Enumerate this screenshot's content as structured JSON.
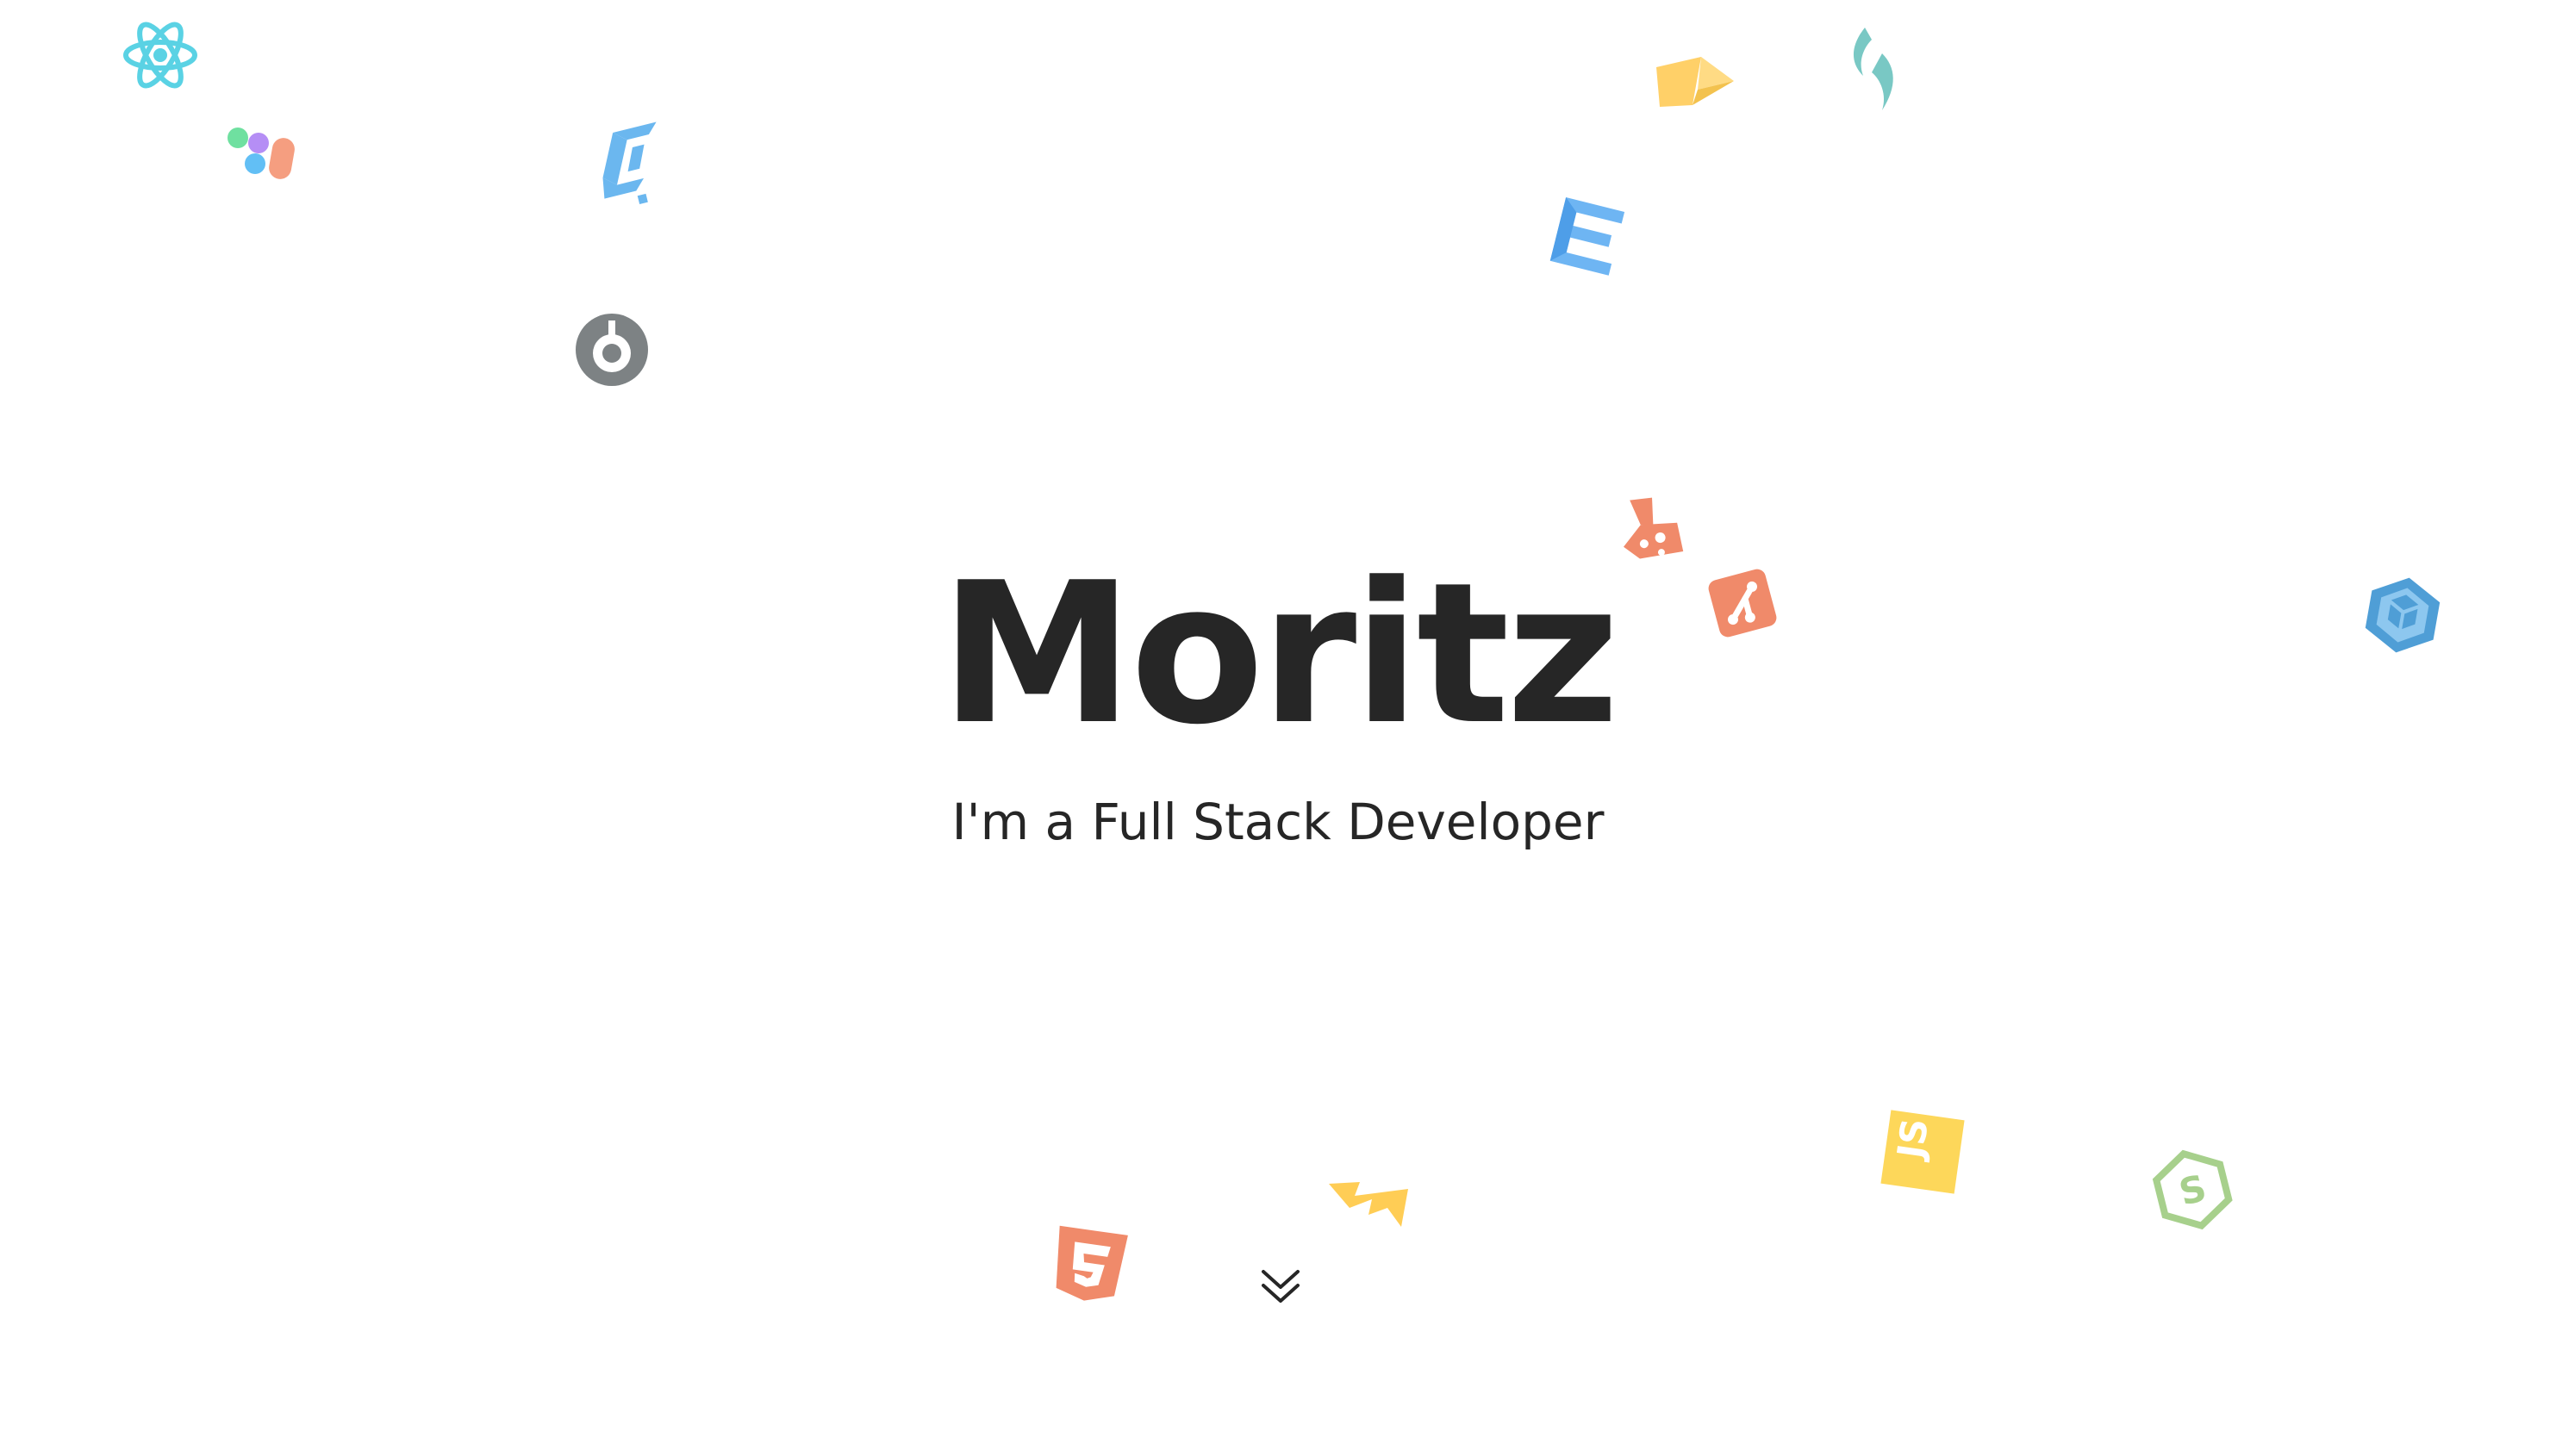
{
  "hero": {
    "name": "Moritz",
    "tagline": "I'm a Full Stack Developer"
  },
  "scroll_hint": {
    "icon": "double-chevron-down-icon"
  },
  "floating_icons": [
    {
      "name": "react-icon",
      "color": "#5ad2e4"
    },
    {
      "name": "figma-icon",
      "color": "#f59e80"
    },
    {
      "name": "webpack-icon",
      "color": "#6bb7ef"
    },
    {
      "name": "circleci-icon",
      "color": "#7d8284"
    },
    {
      "name": "prisma-icon",
      "color": "#ffd068"
    },
    {
      "name": "tailwind-icon",
      "color": "#79c8c4"
    },
    {
      "name": "css3-icon",
      "color": "#6eb5f3"
    },
    {
      "name": "gatling-icon",
      "color": "#f08a6a"
    },
    {
      "name": "git-icon",
      "color": "#f08a6a"
    },
    {
      "name": "kubernetes-cube-icon",
      "color": "#4f9ed6"
    },
    {
      "name": "javascript-icon",
      "color": "#fdd75a"
    },
    {
      "name": "nodejs-icon",
      "color": "#a7d08c"
    },
    {
      "name": "bolt-icon",
      "color": "#ffcd55"
    },
    {
      "name": "html5-icon",
      "color": "#f08a6a"
    }
  ]
}
